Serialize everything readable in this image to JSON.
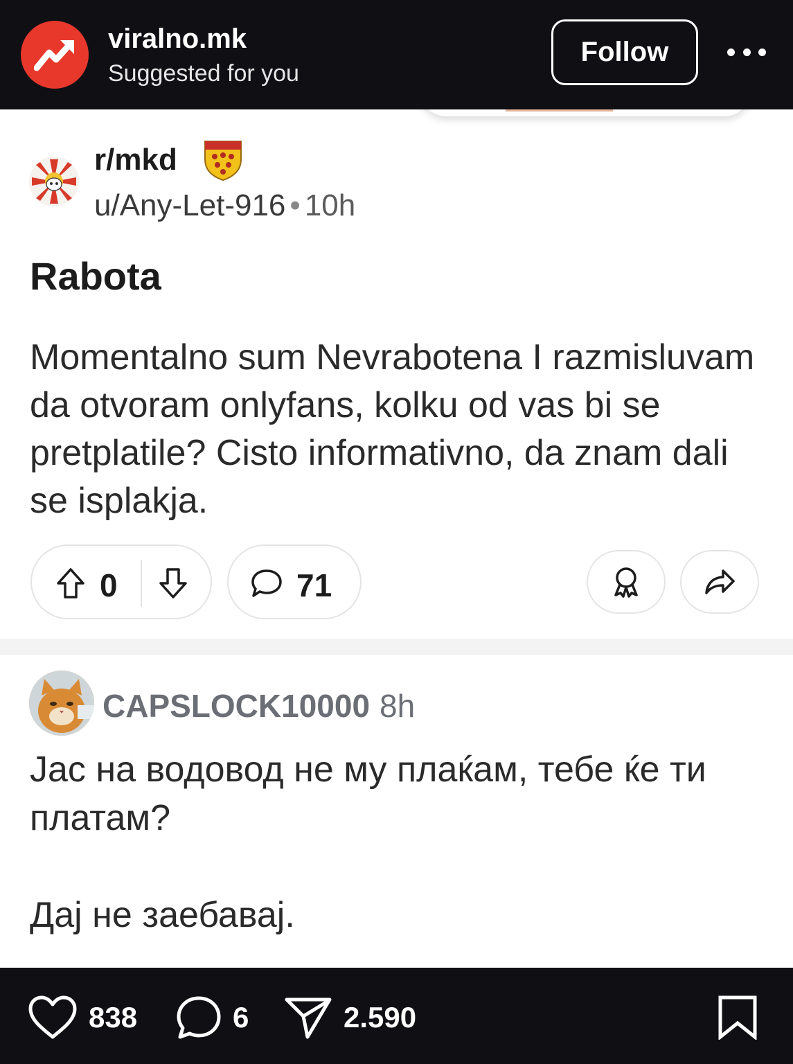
{
  "header": {
    "account_name": "viralno.mk",
    "subtitle": "Suggested for you",
    "follow_label": "Follow",
    "brand_color": "#e8382c"
  },
  "post": {
    "subreddit": "r/mkd",
    "author": "u/Any-Let-916",
    "separator": "•",
    "time": "10h",
    "title": "Rabota",
    "body": "Momentalno sum Nevrabotena I razmisluvam da otvoram onlyfans, kolku od vas bi se pretplatile? Cisto informativno, da znam dali se isplakja.",
    "votes": "0",
    "comments": "71",
    "icons": {
      "upvote": "arrow-up-icon",
      "downvote": "arrow-down-icon",
      "comments": "speech-bubble-icon",
      "award": "award-icon",
      "share": "share-arrow-icon"
    }
  },
  "comment": {
    "username": "CAPSLOCK10000",
    "time": "8h",
    "text_line1": "Јас на водовод не му плаќам, тебе ќе ти платам?",
    "text_line2": "Дај не заебавај."
  },
  "footer": {
    "likes": "838",
    "comments": "6",
    "shares": "2.590",
    "icons": [
      "heart-icon",
      "comment-icon",
      "send-icon",
      "bookmark-icon"
    ]
  }
}
